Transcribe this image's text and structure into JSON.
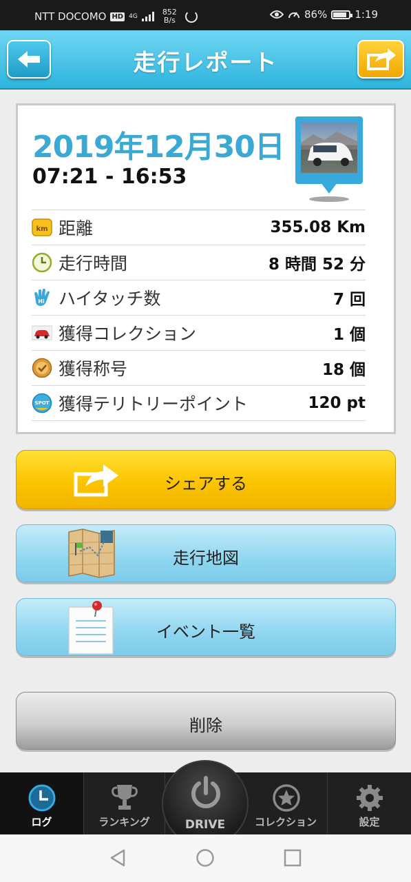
{
  "status_bar": {
    "carrier": "NTT DOCOMO",
    "hd_badge": "HD",
    "network": "4G",
    "speed_value": "852",
    "speed_unit": "B/s",
    "battery": "86%",
    "battery_level": 0.86,
    "time": "1:19"
  },
  "header": {
    "title": "走行レポート",
    "back_icon": "arrow-left-icon",
    "share_icon": "share-arrow-icon"
  },
  "report": {
    "date": "2019年12月30日",
    "time_range": "07:21 - 16:53",
    "km_badge": "km",
    "hitouch_badge": "Hi",
    "spot_badge": "SPOT",
    "stats": [
      {
        "icon": "km-icon",
        "label": "距離",
        "value": "355.08 Km"
      },
      {
        "icon": "clock-icon",
        "label": "走行時間",
        "value": "8 時間 52 分"
      },
      {
        "icon": "high-five-icon",
        "label": "ハイタッチ数",
        "value": "7 回"
      },
      {
        "icon": "car-icon",
        "label": "獲得コレクション",
        "value": "1 個"
      },
      {
        "icon": "medal-icon",
        "label": "獲得称号",
        "value": "18 個"
      },
      {
        "icon": "spot-icon",
        "label": "獲得テリトリーポイント",
        "value": "120 pt"
      }
    ]
  },
  "buttons": {
    "share": "シェアする",
    "map": "走行地図",
    "events": "イベント一覧",
    "delete": "削除"
  },
  "nav": {
    "log": "ログ",
    "ranking": "ランキング",
    "drive": "DRIVE",
    "collection": "コレクション",
    "settings": "設定"
  },
  "colors": {
    "header": "#2eb4dd",
    "date": "#3ba9d4",
    "share_button": "#fbc400",
    "blue_button": "#90d6f0",
    "active_nav": "#2fa8e0"
  }
}
